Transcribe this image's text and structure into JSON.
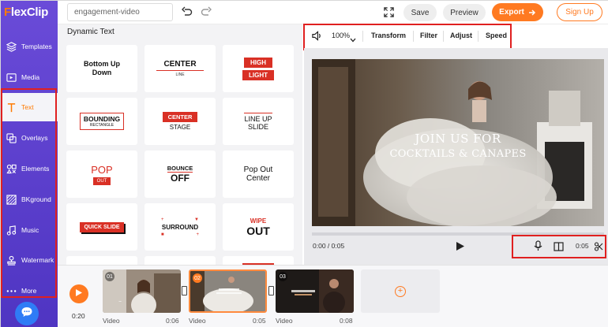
{
  "app": {
    "logo_f": "F",
    "logo_rest": "lexClip"
  },
  "sidebar": {
    "items": [
      {
        "label": "Templates",
        "icon": "layers-icon"
      },
      {
        "label": "Media",
        "icon": "media-icon"
      },
      {
        "label": "Text",
        "icon": "text-icon"
      },
      {
        "label": "Overlays",
        "icon": "overlays-icon"
      },
      {
        "label": "Elements",
        "icon": "elements-icon"
      },
      {
        "label": "BKground",
        "icon": "background-icon"
      },
      {
        "label": "Music",
        "icon": "music-icon"
      },
      {
        "label": "Watermark",
        "icon": "watermark-icon"
      },
      {
        "label": "More",
        "icon": "more-icon"
      }
    ],
    "active": "Text"
  },
  "topbar": {
    "project_name": "engagement-video",
    "save_label": "Save",
    "preview_label": "Preview",
    "export_label": "Export",
    "signup_label": "Sign Up"
  },
  "panel": {
    "title": "Dynamic Text",
    "cards": [
      {
        "line1": "Bottom Up",
        "line2": "Down"
      },
      {
        "line1": "CENTER",
        "line2": "LINE"
      },
      {
        "line1": "HIGH",
        "line2": "LIGHT"
      },
      {
        "line1": "BOUNDING",
        "line2": "RECTANGLE"
      },
      {
        "line1": "CENTER",
        "line2": "STAGE"
      },
      {
        "line1": "LINE UP",
        "line2": "SLIDE"
      },
      {
        "line1": "POP",
        "line2": "OUT"
      },
      {
        "line1": "BOUNCE",
        "line2": "OFF"
      },
      {
        "line1": "Pop Out",
        "line2": "Center"
      },
      {
        "line1": "QUICK SLIDE",
        "line2": ""
      },
      {
        "line1": "SURROUND",
        "line2": ""
      },
      {
        "line1": "WIPE",
        "line2": "OUT"
      }
    ]
  },
  "toolbar": {
    "zoom": "100%",
    "transform": "Transform",
    "filter": "Filter",
    "adjust": "Adjust",
    "speed": "Speed"
  },
  "preview": {
    "overlay_line1": "JOIN US FOR",
    "overlay_line2": "COCKTAILS & CANAPES",
    "time_current": "0:00 / 0:05",
    "clip_length": "0:05"
  },
  "timeline": {
    "total_time": "0:20",
    "clips": [
      {
        "num": "01",
        "label": "Video",
        "duration": "0:06"
      },
      {
        "num": "02",
        "label": "Video",
        "duration": "0:05"
      },
      {
        "num": "03",
        "label": "Video",
        "duration": "0:08"
      }
    ],
    "add_label": "+"
  },
  "colors": {
    "sidebar": "#5a3fd0",
    "accent": "#ff7a21",
    "highlight_box": "#e02020",
    "chat": "#2f7cf6"
  }
}
